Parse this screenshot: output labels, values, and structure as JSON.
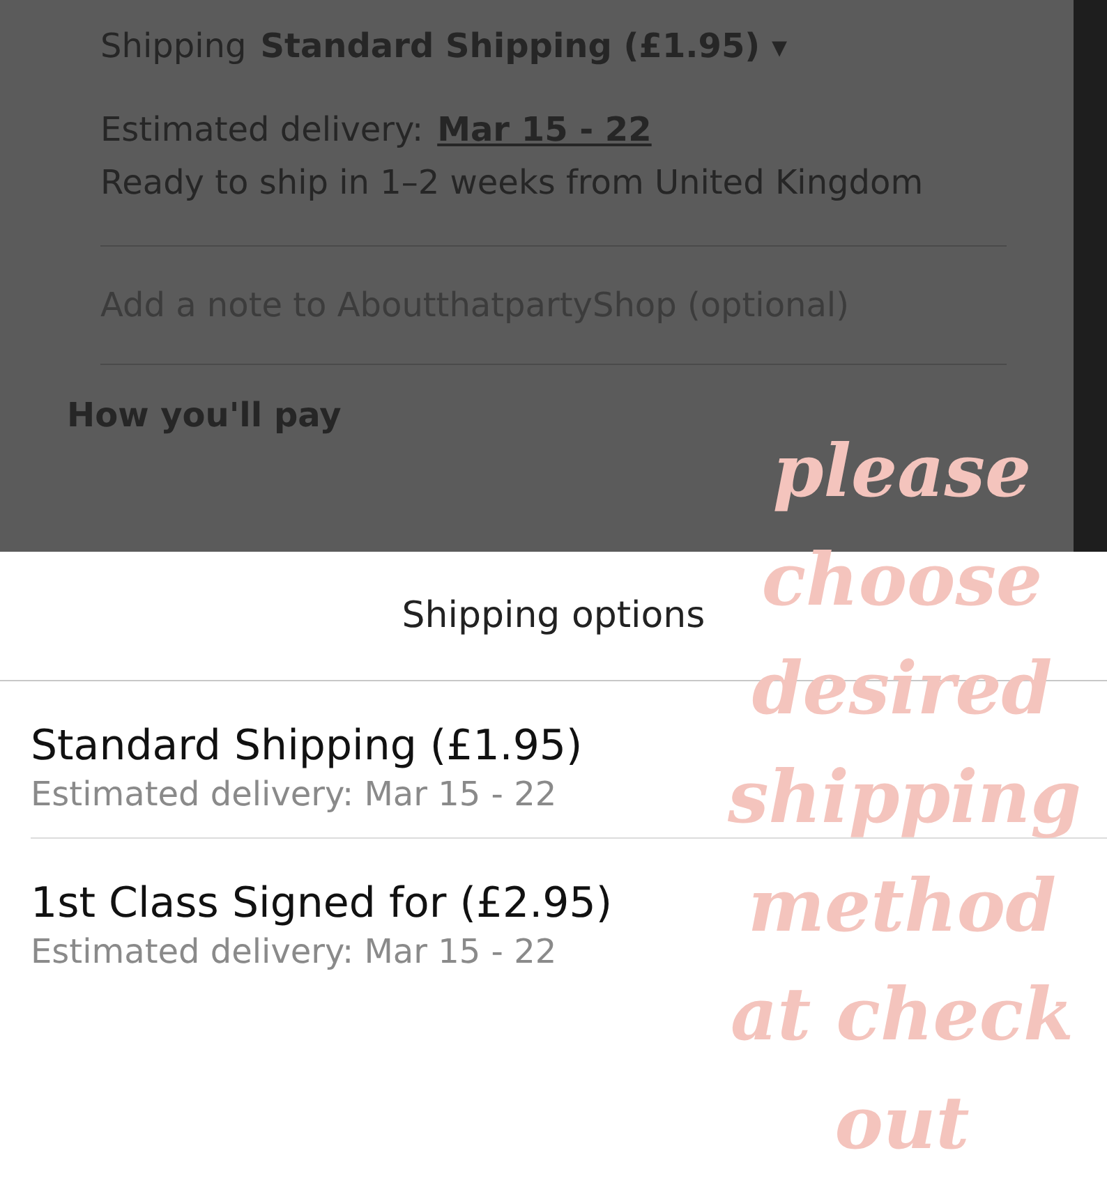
{
  "checkout": {
    "shipping_label": "Shipping",
    "shipping_value": "Standard Shipping (£1.95)",
    "dropdown_glyph": "▾",
    "delivery_label": "Estimated delivery:",
    "delivery_dates": "Mar 15 - 22",
    "ready_text": "Ready to ship in 1–2 weeks from United Kingdom",
    "note_placeholder": "Add a note to AboutthatpartyShop (optional)",
    "pay_heading": "How you'll pay"
  },
  "sheet": {
    "title": "Shipping options",
    "options": [
      {
        "name": "Standard Shipping (£1.95)",
        "delivery": "Estimated delivery: Mar 15 - 22"
      },
      {
        "name": "1st Class Signed for (£2.95)",
        "delivery": "Estimated delivery: Mar 15 - 22"
      }
    ]
  },
  "annotation": "please choose desired shipping method at check out"
}
